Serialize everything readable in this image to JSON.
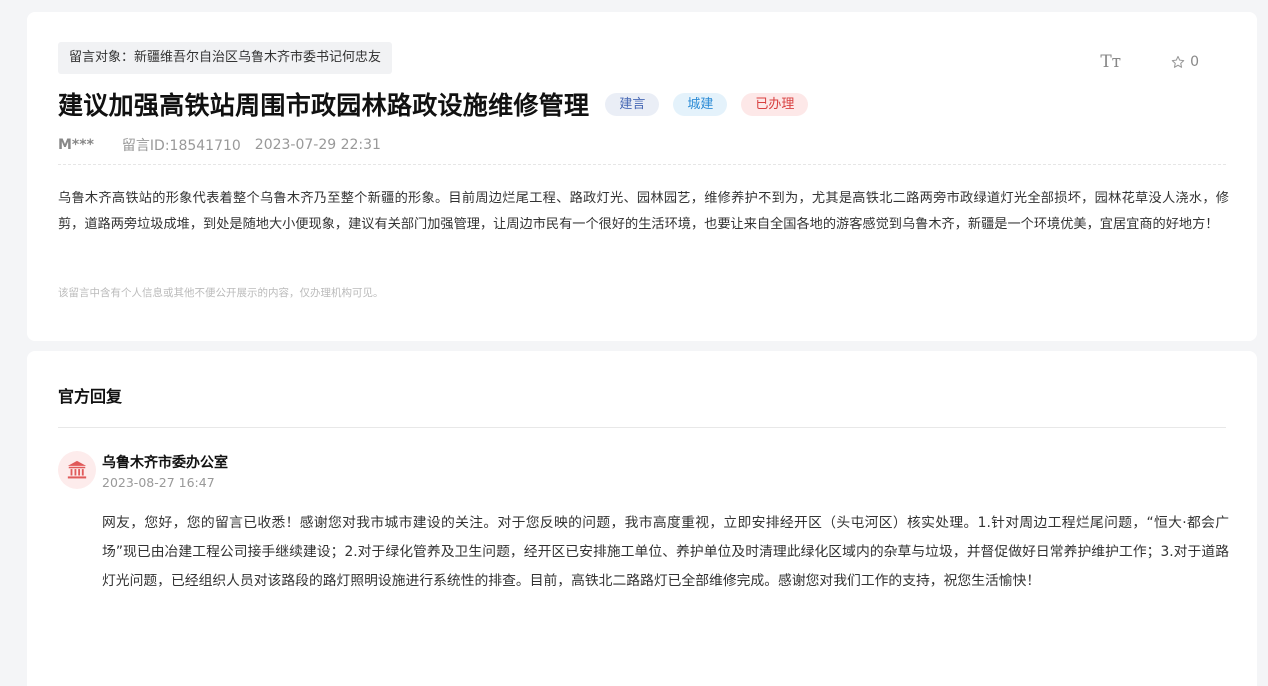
{
  "message": {
    "target_label": "留言对象：",
    "target_value": "新疆维吾尔自治区乌鲁木齐市委书记何忠友",
    "font_size_label": "Tт",
    "favorite_count": "0",
    "title": "建议加强高铁站周围市政园林路政设施维修管理",
    "tags": [
      "建言",
      "城建",
      "已办理"
    ],
    "author": "M***",
    "message_id": "留言ID:18541710",
    "date": "2023-07-29 22:31",
    "content": "乌鲁木齐高铁站的形象代表着整个乌鲁木齐乃至整个新疆的形象。目前周边烂尾工程、路政灯光、园林园艺，维修养护不到为，尤其是高铁北二路两旁市政绿道灯光全部损坏，园林花草没人浇水，修剪，道路两旁垃圾成堆，到处是随地大小便现象，建议有关部门加强管理，让周边市民有一个很好的生活环境，也要让来自全国各地的游客感觉到乌鲁木齐，新疆是一个环境优美，宜居宜商的好地方！",
    "privacy_note": "该留言中含有个人信息或其他不便公开展示的内容，仅办理机构可见。"
  },
  "reply": {
    "section_title": "官方回复",
    "org_name": "乌鲁木齐市委办公室",
    "date": "2023-08-27 16:47",
    "content": "网友，您好，您的留言已收悉！感谢您对我市城市建设的关注。对于您反映的问题，我市高度重视，立即安排经开区（头屯河区）核实处理。1.针对周边工程烂尾问题，“恒大·都会广场”现已由冶建工程公司接手继续建设；2.对于绿化管养及卫生问题，经开区已安排施工单位、养护单位及时清理此绿化区域内的杂草与垃圾，并督促做好日常养护维护工作；3.对于道路灯光问题，已经组织人员对该路段的路灯照明设施进行系统性的排查。目前，高铁北二路路灯已全部维修完成。感谢您对我们工作的支持，祝您生活愉快！"
  },
  "icons": {
    "font_size": "font-size-icon",
    "favorite": "star-icon",
    "organization": "government-building-icon"
  },
  "colors": {
    "tag_suggestion": "#4869b5",
    "tag_urban": "#2d8cd6",
    "tag_done": "#d94040",
    "org_icon": "#e05a5a"
  }
}
